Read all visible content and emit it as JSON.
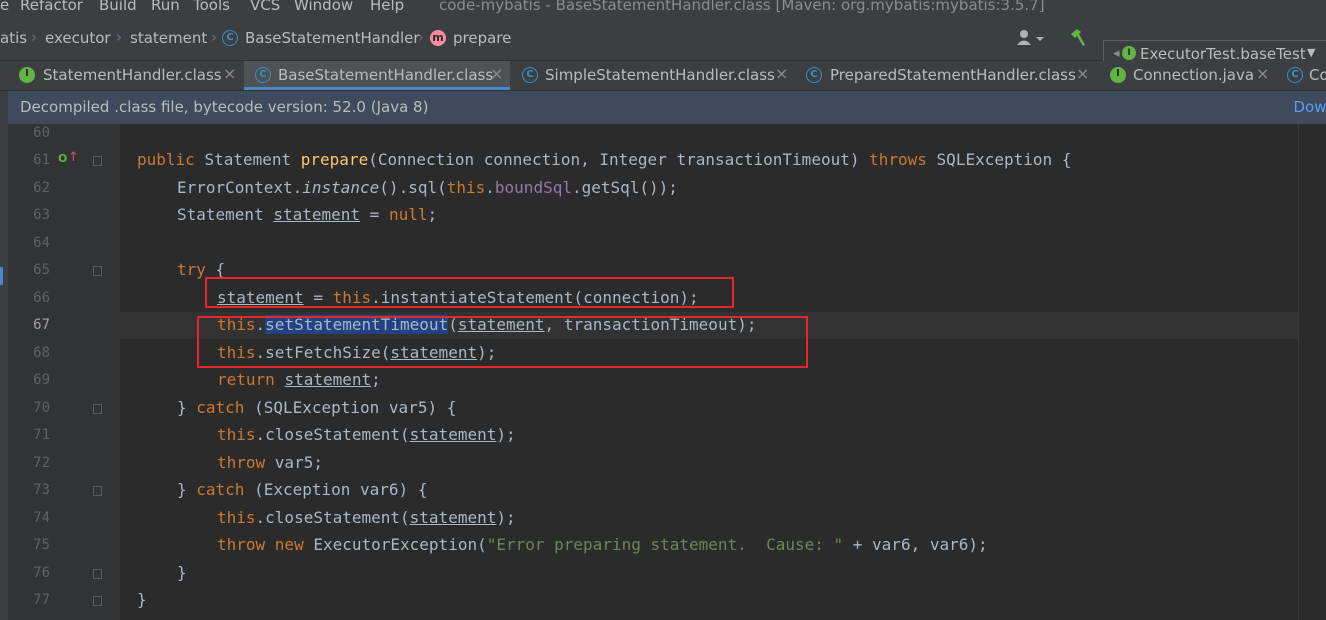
{
  "menu": {
    "items": [
      "e",
      "Refactor",
      "Build",
      "Run",
      "Tools",
      "VCS",
      "Window",
      "Help"
    ],
    "window_title": "code-mybatis - BaseStatementHandler.class [Maven: org.mybatis:mybatis:3.5.7]"
  },
  "breadcrumb": {
    "items": [
      "atis",
      "executor",
      "statement",
      "BaseStatementHandler",
      "prepare"
    ],
    "class_icon_letter": "C",
    "method_icon_letter": "m"
  },
  "toolbar": {
    "user_icon": "user-icon",
    "build_icon": "hammer-icon",
    "run_config": "ExecutorTest.baseTest"
  },
  "tabs": [
    {
      "label": "StatementHandler.class",
      "icon": "I",
      "active": false
    },
    {
      "label": "BaseStatementHandler.class",
      "icon": "C",
      "active": true
    },
    {
      "label": "SimpleStatementHandler.class",
      "icon": "C",
      "active": false
    },
    {
      "label": "PreparedStatementHandler.class",
      "icon": "C",
      "active": false
    },
    {
      "label": "Connection.java",
      "icon": "I",
      "active": false
    },
    {
      "label": "Co",
      "icon": "C",
      "active": false
    }
  ],
  "banner": {
    "text": "Decompiled .class file, bytecode version: 52.0 (Java 8)",
    "link": "Down"
  },
  "editor": {
    "line_numbers": [
      "60",
      "61",
      "62",
      "63",
      "64",
      "65",
      "66",
      "67",
      "68",
      "69",
      "70",
      "71",
      "72",
      "73",
      "74",
      "75",
      "76",
      "77"
    ],
    "current_line": "67",
    "code": {
      "l61": {
        "kw1": "public ",
        "t1": "Statement ",
        "fn": "prepare",
        "t2": "(Connection connection, Integer transactionTimeout) ",
        "kw2": "throws ",
        "t3": "SQLException {"
      },
      "l62": {
        "t1": "ErrorContext.",
        "it": "instance",
        "t2": "().sql(",
        "kw": "this",
        "t3": ".",
        "fld": "boundSql",
        "t4": ".getSql());"
      },
      "l63": {
        "t1": "Statement ",
        "ul": "statement",
        "t2": " = ",
        "kw": "null",
        "t3": ";"
      },
      "l65": {
        "kw": "try ",
        "t1": "{"
      },
      "l66": {
        "ul": "statement",
        "t1": " = ",
        "kw": "this",
        "t2": ".instantiateStatement(connection);"
      },
      "l67": {
        "kw": "this",
        "t1": ".",
        "sel": "setStatementTimeout",
        "t2": "(",
        "ul": "statement",
        "t3": ", transactionTimeout);"
      },
      "l68": {
        "kw": "this",
        "t1": ".setFetchSize(",
        "ul": "statement",
        "t2": ");"
      },
      "l69": {
        "kw": "return ",
        "ul": "statement",
        "t1": ";"
      },
      "l70": {
        "t1": "} ",
        "kw": "catch ",
        "t2": "(SQLException var5) {"
      },
      "l71": {
        "kw": "this",
        "t1": ".closeStatement(",
        "ul": "statement",
        "t2": ");"
      },
      "l72": {
        "kw": "throw ",
        "t1": "var5;"
      },
      "l73": {
        "t1": "} ",
        "kw": "catch ",
        "t2": "(Exception var6) {"
      },
      "l74": {
        "kw": "this",
        "t1": ".closeStatement(",
        "ul": "statement",
        "t2": ");"
      },
      "l75": {
        "kw1": "throw ",
        "kw2": "new ",
        "t1": "ExecutorException(",
        "str": "\"Error preparing statement.  Cause: \"",
        "t2": " + var6, var6);"
      },
      "l76": {
        "t1": "}"
      },
      "l77": {
        "t1": "}"
      }
    }
  }
}
